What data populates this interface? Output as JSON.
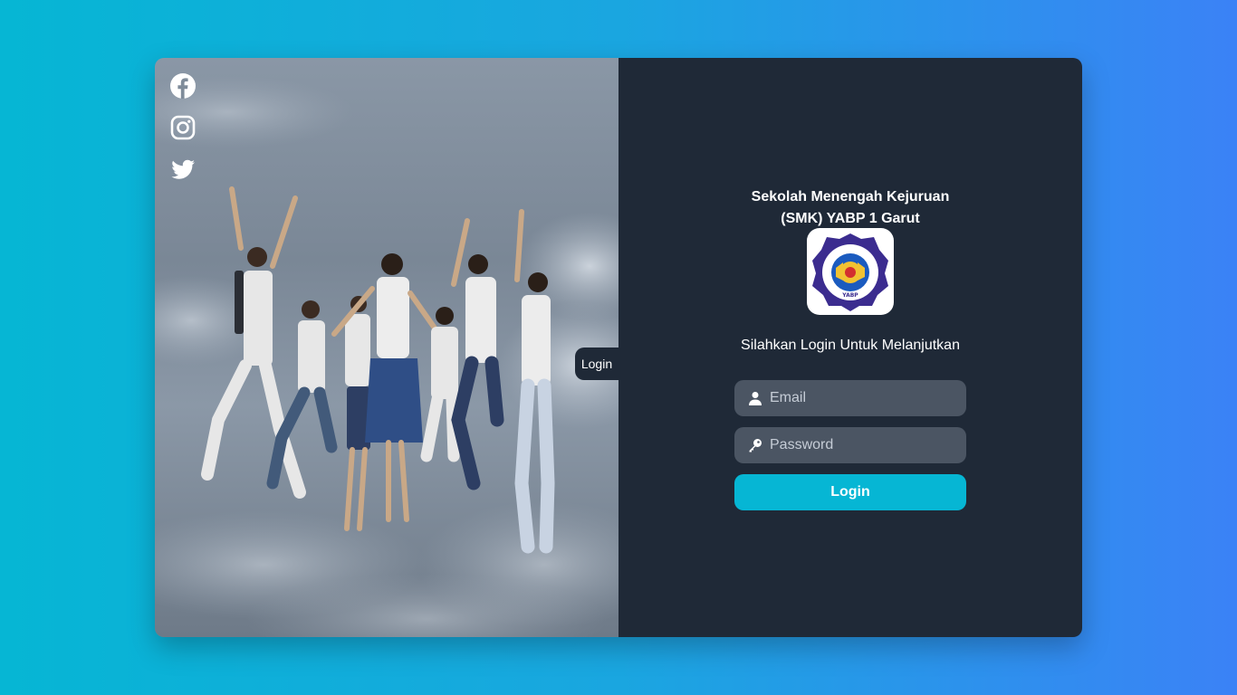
{
  "social": {
    "items": [
      {
        "name": "facebook-icon"
      },
      {
        "name": "instagram-icon"
      },
      {
        "name": "twitter-icon"
      }
    ]
  },
  "side_tab": {
    "label": "Login"
  },
  "school": {
    "name_line1": "Sekolah Menengah Kejuruan",
    "name_line2": "(SMK) YABP 1 Garut",
    "logo_text": "SEKOLAH MENENGAH KEJURUAN",
    "logo_subtext": "YABP"
  },
  "form": {
    "subtitle": "Silahkan Login Untuk Melanjutkan",
    "email_placeholder": "Email",
    "password_placeholder": "Password",
    "submit_label": "Login"
  },
  "colors": {
    "accent": "#06b6d4",
    "panel": "#1f2937",
    "input_bg": "#4b5563",
    "gradient_start": "#06b6d4",
    "gradient_end": "#3b82f6"
  }
}
